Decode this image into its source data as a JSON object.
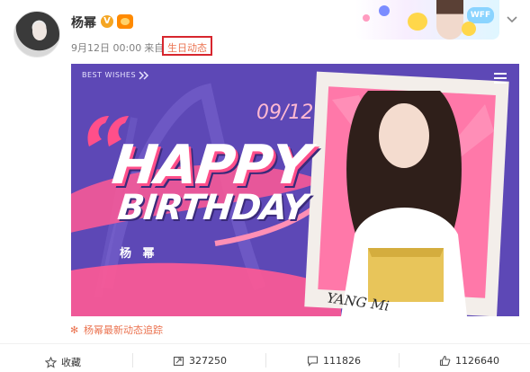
{
  "user": {
    "name": "杨幂",
    "verified_badge": "V"
  },
  "post": {
    "time": "9月12日 00:00",
    "source_prefix": "来自",
    "source": "生日动态",
    "banner": {
      "header_text": "BEST WISHES",
      "date": "09/12",
      "title_line1": "HAPPY",
      "title_line2": "BIRTHDAY",
      "name": "杨 幂",
      "signature": "YANG Mi"
    },
    "related": "杨幂最新动态追踪"
  },
  "decor": {
    "badge_text": "WFF"
  },
  "actions": {
    "favorite": "收藏",
    "repost": "327250",
    "comment": "111826",
    "like": "1126640"
  },
  "colors": {
    "accent": "#eb7350",
    "highlight_box": "#d7262e",
    "banner_bg": "#5d48b6",
    "banner_pink": "#ff4f8a"
  }
}
